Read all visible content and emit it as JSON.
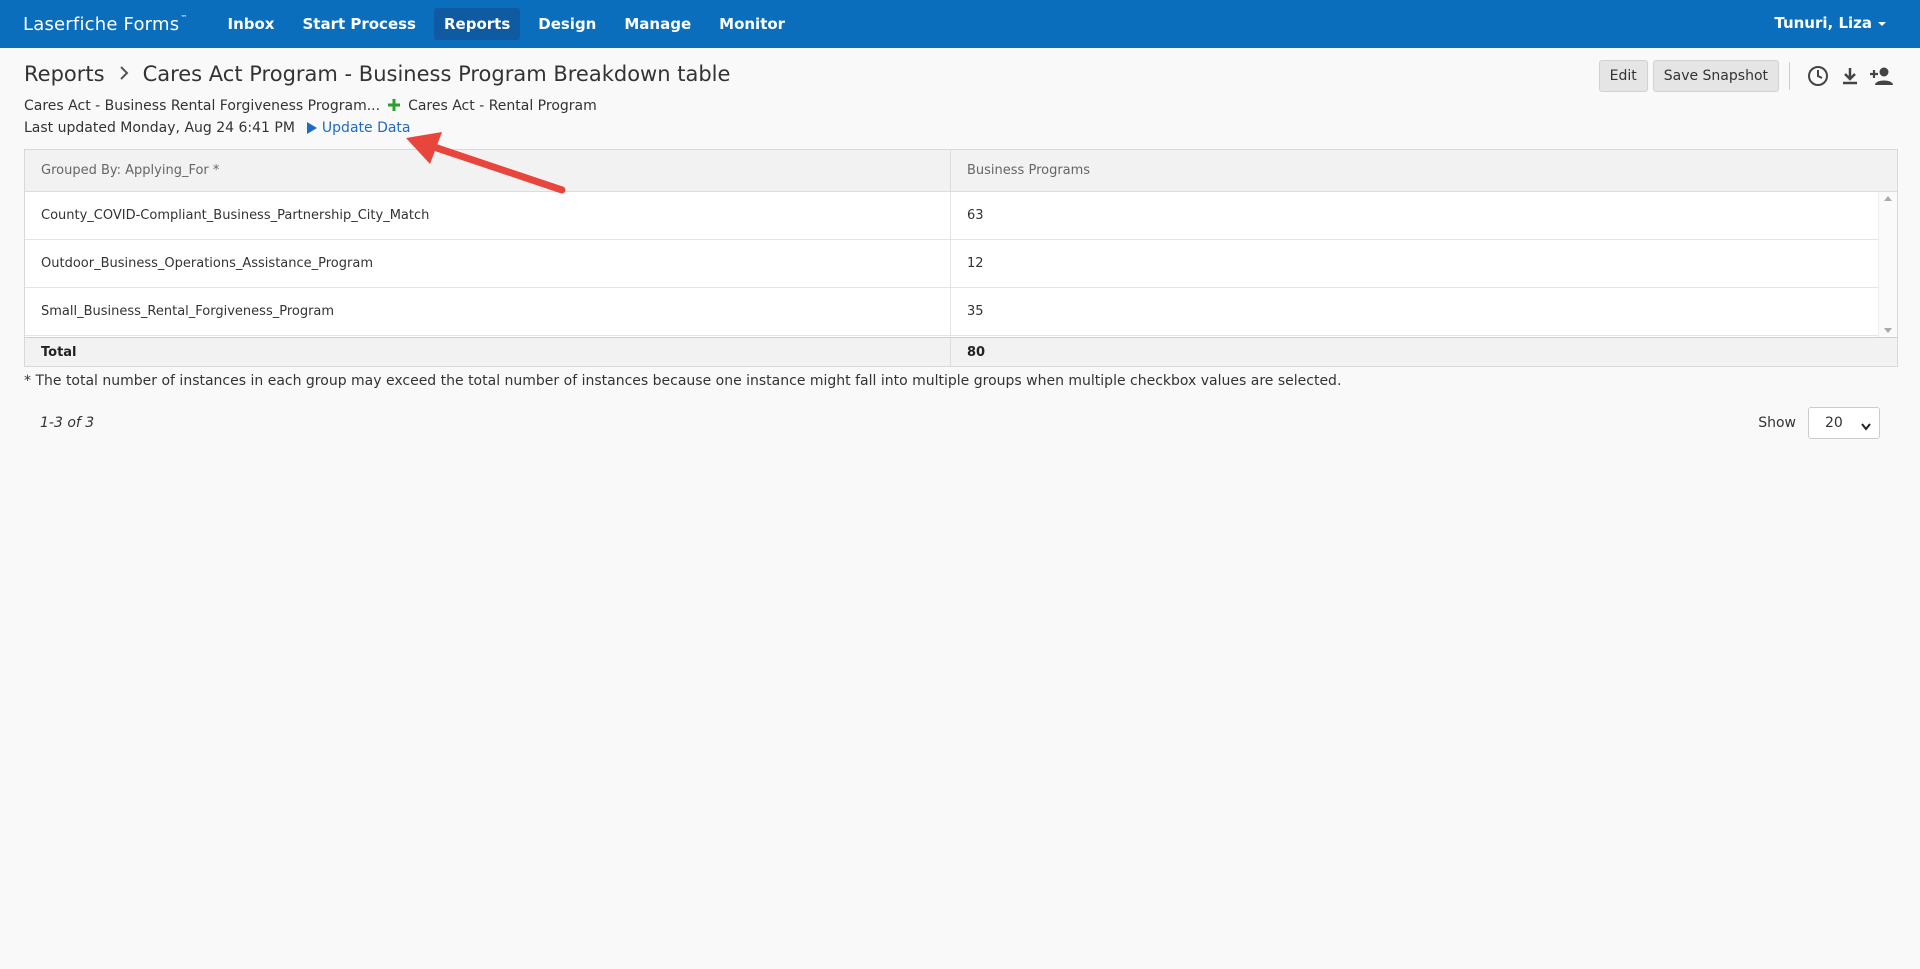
{
  "app": {
    "brand": "Laserfiche Forms",
    "trademark": "™"
  },
  "nav": {
    "items": [
      {
        "label": "Inbox",
        "active": false
      },
      {
        "label": "Start Process",
        "active": false
      },
      {
        "label": "Reports",
        "active": true
      },
      {
        "label": "Design",
        "active": false
      },
      {
        "label": "Manage",
        "active": false
      },
      {
        "label": "Monitor",
        "active": false
      }
    ],
    "user": "Tunuri, Liza"
  },
  "breadcrumb": {
    "root": "Reports",
    "current": "Cares Act Program - Business Program Breakdown table"
  },
  "subline": {
    "report_a": "Cares Act - Business Rental Forgiveness Program...",
    "report_b": "Cares Act - Rental Program"
  },
  "status": {
    "updated": "Last updated Monday, Aug 24 6:41 PM",
    "update_link": "Update Data"
  },
  "actions": {
    "edit": "Edit",
    "snapshot": "Save Snapshot"
  },
  "table": {
    "headers": [
      "Grouped By: Applying_For *",
      "Business Programs"
    ],
    "rows": [
      [
        "County_COVID-Compliant_Business_Partnership_City_Match",
        "63"
      ],
      [
        "Outdoor_Business_Operations_Assistance_Program",
        "12"
      ],
      [
        "Small_Business_Rental_Forgiveness_Program",
        "35"
      ]
    ],
    "total_label": "Total",
    "total_value": "80"
  },
  "note": "* The total number of instances in each group may exceed the total number of instances because one instance might fall into multiple groups when multiple checkbox values are selected.",
  "pagination": {
    "range": "1-3 of 3",
    "show_label": "Show",
    "page_size": "20"
  },
  "colors": {
    "nav_bg": "#0a6ebd",
    "link": "#1d6bc2",
    "plus": "#2d9d2d",
    "annotation": "#e8453c"
  }
}
